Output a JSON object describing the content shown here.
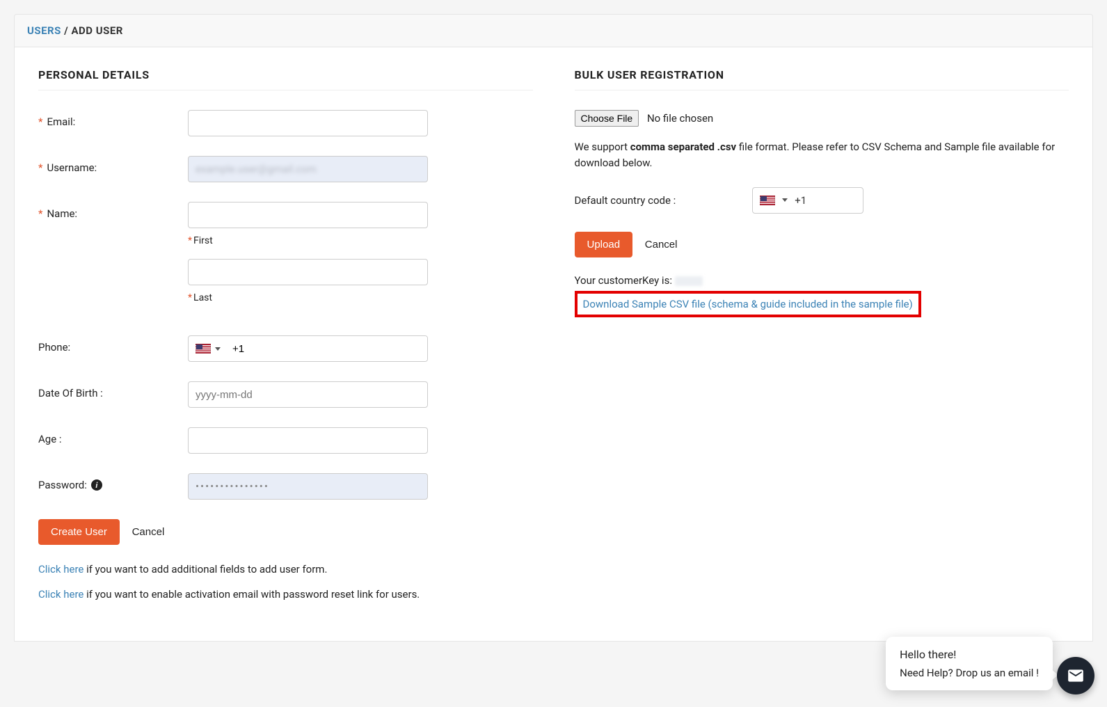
{
  "breadcrumb": {
    "root": "USERS",
    "separator": "/",
    "current": "ADD USER"
  },
  "personal": {
    "title": "PERSONAL DETAILS",
    "email_label": "Email:",
    "username_label": "Username:",
    "username_value": "",
    "name_label": "Name:",
    "first_sub": "First",
    "last_sub": "Last",
    "phone_label": "Phone:",
    "phone_code": "+1",
    "dob_label": "Date Of Birth :",
    "dob_placeholder": "yyyy-mm-dd",
    "age_label": "Age :",
    "password_label": "Password:",
    "password_value": "•••••••••••••••",
    "create_btn": "Create User",
    "cancel_btn": "Cancel",
    "hint1_link": "Click here",
    "hint1_rest": " if you want to add additional fields to add user form.",
    "hint2_link": "Click here",
    "hint2_rest": " if you want to enable activation email with password reset link for users."
  },
  "bulk": {
    "title": "BULK USER REGISTRATION",
    "choose_file": "Choose File",
    "no_file": "No file chosen",
    "support_pre": "We support ",
    "support_strong": "comma separated .csv",
    "support_post": " file format. Please refer to CSV Schema and Sample file available for download below.",
    "cc_label": "Default country code :",
    "cc_value": "+1",
    "upload_btn": "Upload",
    "cancel_btn": "Cancel",
    "ck_label": "Your customerKey is:",
    "download_link": "Download Sample CSV file (schema & guide included in the sample file)"
  },
  "chat": {
    "greet": "Hello there!",
    "help": "Need Help? Drop us an email !"
  }
}
